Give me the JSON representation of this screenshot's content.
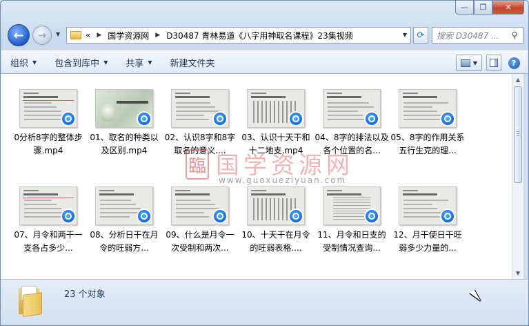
{
  "window": {
    "min_label": "—",
    "max_label": "❐",
    "close_label": "✕"
  },
  "nav": {
    "back": "←",
    "forward": "→",
    "breadcrumb_prefix": "«",
    "crumbs": [
      "国学资源网",
      "D30487 青林易道《八字用神取名课程》23集视频"
    ],
    "search_placeholder": "搜索 D30487 ..."
  },
  "toolbar": {
    "organize": "组织",
    "include_library": "包含到库中",
    "share": "共享",
    "new_folder": "新建文件夹"
  },
  "files": [
    {
      "label": "0分析8字的整体步骤.mp4",
      "thumb": "text"
    },
    {
      "label": "01、取名的种类以及区别.mp4",
      "thumb": "cover"
    },
    {
      "label": "02、认识8字和8字取名的意义....",
      "thumb": "text"
    },
    {
      "label": "03、认识十天干和十二地支.mp4",
      "thumb": "table"
    },
    {
      "label": "04、8字的排法以及各个位置的名...",
      "thumb": "text"
    },
    {
      "label": "05、8字的作用关系五行生克的理...",
      "thumb": "text"
    },
    {
      "label": "07、月令和两干一支各占多少...",
      "thumb": "text"
    },
    {
      "label": "08、分析日干在月令的旺弱方...",
      "thumb": "text"
    },
    {
      "label": "09、什么是月令一次受制和两次...",
      "thumb": "text"
    },
    {
      "label": "10、十天干在月令的旺弱表格....",
      "thumb": "table"
    },
    {
      "label": "11、月令和日支的受制情况查询...",
      "thumb": "rows"
    },
    {
      "label": "12、月干使日干旺弱多少力量的...",
      "thumb": "text"
    }
  ],
  "watermark": {
    "name": "国学资源网",
    "url": "www.guoxueziyuan.com",
    "seal_char": "臨"
  },
  "status": {
    "count": "23 个对象"
  },
  "icons": [
    "folder-icon",
    "refresh-icon",
    "search-icon",
    "view-icon",
    "preview-pane-icon",
    "help-icon",
    "video-icon"
  ]
}
